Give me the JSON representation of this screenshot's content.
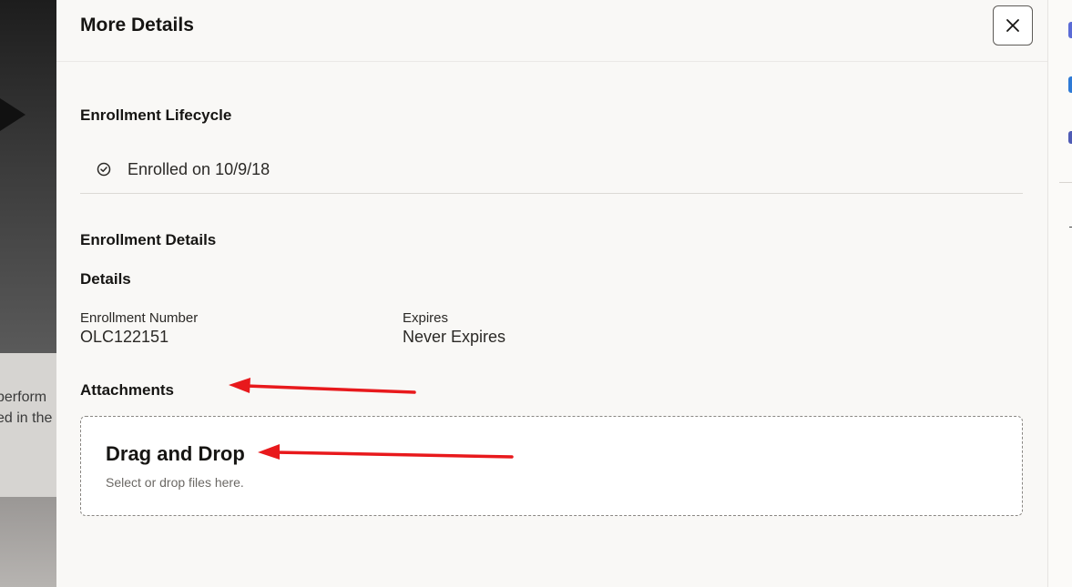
{
  "background": {
    "text_lines": [
      "perform",
      "ed in the"
    ]
  },
  "drawer": {
    "title": "More Details",
    "close_icon": "close-icon",
    "lifecycle": {
      "heading": "Enrollment Lifecycle",
      "status_icon": "check-circle-icon",
      "status_text": "Enrolled on 10/9/18"
    },
    "enrollment_details": {
      "heading": "Enrollment Details",
      "subheading": "Details",
      "fields": [
        {
          "label": "Enrollment Number",
          "value": "OLC122151"
        },
        {
          "label": "Expires",
          "value": "Never Expires"
        }
      ]
    },
    "attachments": {
      "heading": "Attachments",
      "dropzone_title": "Drag and Drop",
      "dropzone_hint": "Select or drop files here."
    }
  },
  "colors": {
    "accent_arrow": "#e8191c",
    "panel_bg": "#f9f8f6",
    "text_primary": "#161513"
  }
}
